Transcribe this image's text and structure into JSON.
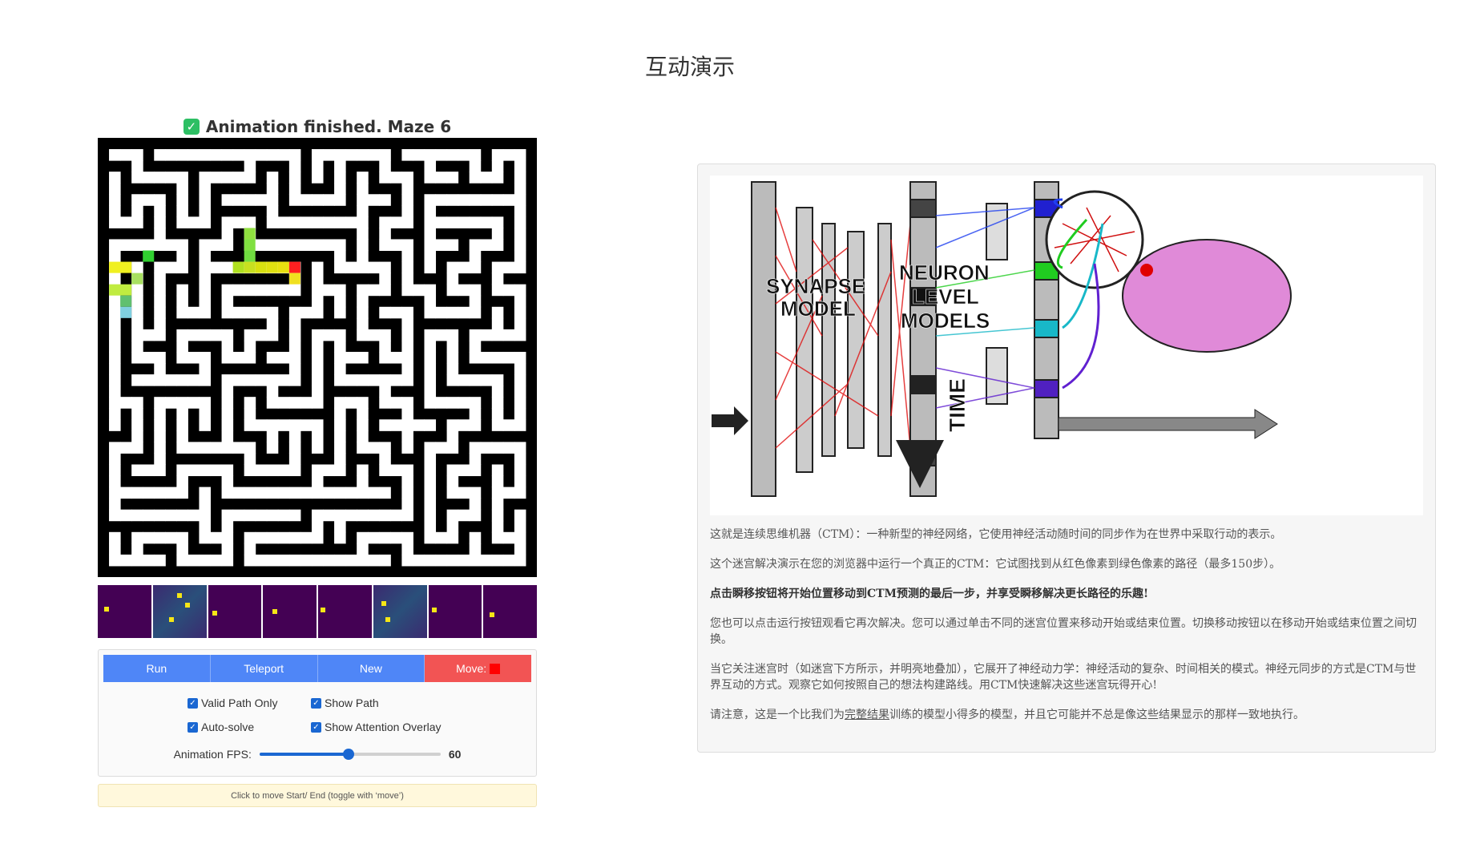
{
  "page": {
    "title": "互动演示"
  },
  "status": {
    "icon": "check-icon",
    "text": "Animation finished. Maze 6"
  },
  "maze": {
    "number": "6"
  },
  "thumbnails": [
    {
      "name": "attention-frame-1"
    },
    {
      "name": "attention-frame-2"
    },
    {
      "name": "attention-frame-3"
    },
    {
      "name": "attention-frame-4"
    },
    {
      "name": "attention-frame-5"
    },
    {
      "name": "attention-frame-6"
    },
    {
      "name": "attention-frame-7"
    },
    {
      "name": "attention-frame-8"
    }
  ],
  "controls": {
    "run_label": "Run",
    "teleport_label": "Teleport",
    "new_label": "New",
    "move_label": "Move:",
    "move_color": "#ff0000",
    "valid_path_label": "Valid Path Only",
    "show_path_label": "Show Path",
    "auto_solve_label": "Auto-solve",
    "show_attention_label": "Show Attention Overlay",
    "valid_path_checked": true,
    "show_path_checked": true,
    "auto_solve_checked": true,
    "show_attention_checked": true,
    "fps_label": "Animation FPS:",
    "fps_value": "60",
    "fps_fraction": 0.49
  },
  "hint": {
    "text": "Click to move Start/ End (toggle with   ‘move’)"
  },
  "figure": {
    "synapse_label_1": "SYNAPSE",
    "synapse_label_2": "MODEL",
    "neuron_label_1": "NEURON",
    "neuron_label_2": "LEVEL",
    "neuron_label_3": "MODELS",
    "time_label": "TIME"
  },
  "description": {
    "p1": "这就是连续思维机器（CTM）：一种新型的神经网络，它使用神经活动随时间的同步作为在世界中采取行动的表示。",
    "p2": "这个迷宫解决演示在您的浏览器中运行一个真正的CTM：它试图找到从红色像素到绿色像素的路径（最多150步）。",
    "p3": "点击瞬移按钮将开始位置移动到CTM预测的最后一步，并享受瞬移解决更长路径的乐趣!",
    "p4": "您也可以点击运行按钮观看它再次解决。您可以通过单击不同的迷宫位置来移动开始或结束位置。切换移动按钮以在移动开始或结束位置之间切换。",
    "p5": "当它关注迷宫时（如迷宫下方所示，并明亮地叠加），它展开了神经动力学：神经活动的复杂、时间相关的模式。神经元同步的方式是CTM与世界互动的方式。观察它如何按照自己的想法构建路线。用CTM快速解决这些迷宫玩得开心!",
    "p6_before": "请注意，这是一个比我们为",
    "p6_link": "完整结果",
    "p6_after": "训练的模型小得多的模型，并且它可能并不总是像这些结果显示的那样一致地执行。"
  }
}
